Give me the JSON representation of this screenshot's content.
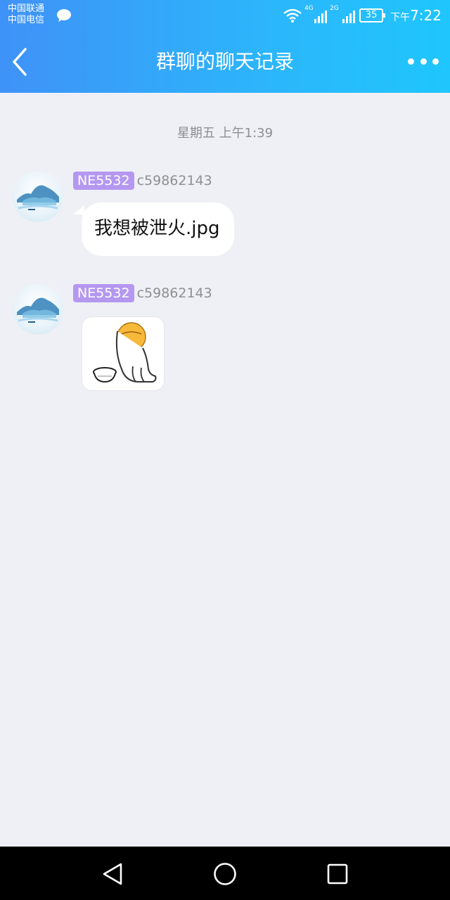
{
  "status_bar": {
    "carrier_1": "中国联通",
    "carrier_2": "中国电信",
    "network_1": "4G",
    "network_2": "2G",
    "battery": "35",
    "time_prefix": "下午",
    "time": "7:22"
  },
  "nav": {
    "title": "群聊的聊天记录"
  },
  "chat": {
    "timestamp": "星期五 上午1:39",
    "messages": [
      {
        "badge": "NE5532",
        "sender": "c59862143",
        "type": "text",
        "text": "我想被泄火.jpg"
      },
      {
        "badge": "NE5532",
        "sender": "c59862143",
        "type": "sticker"
      }
    ]
  },
  "colors": {
    "header_gradient_start": "#3f92f7",
    "header_gradient_end": "#1fc6fd",
    "badge": "#b498f0",
    "background": "#eff0f5"
  }
}
